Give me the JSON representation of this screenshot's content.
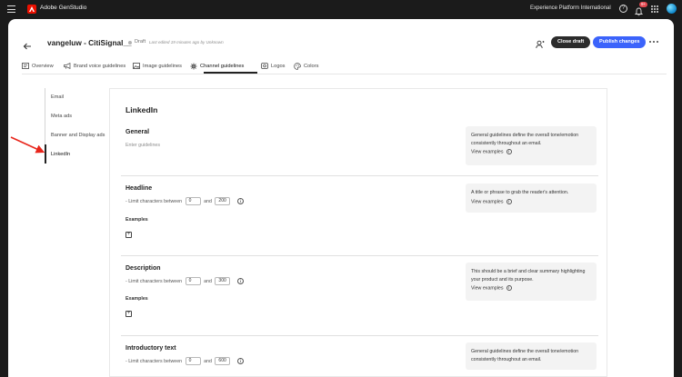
{
  "topbar": {
    "app_name": "Adobe GenStudio",
    "org_name": "Experience Platform International",
    "notification_count": "9+"
  },
  "header": {
    "title": "vangeluw - CitiSignal__",
    "status": "Draft",
    "last_edited": "Last edited 19 minutes ago by Unknown",
    "close_draft_label": "Close draft",
    "publish_label": "Publish changes"
  },
  "tabs": [
    {
      "label": "Overview",
      "icon": "overview-icon"
    },
    {
      "label": "Brand voice guidelines",
      "icon": "megaphone-icon"
    },
    {
      "label": "Image guidelines",
      "icon": "image-icon"
    },
    {
      "label": "Channel guidelines",
      "icon": "channel-icon",
      "active": true
    },
    {
      "label": "Logos",
      "icon": "logo-icon"
    },
    {
      "label": "Colors",
      "icon": "palette-icon"
    }
  ],
  "channels": [
    "Email",
    "Meta ads",
    "Banner and Display ads",
    "LinkedIn"
  ],
  "active_channel": "LinkedIn",
  "content": {
    "channel_title": "LinkedIn",
    "general": {
      "title": "General",
      "placeholder": "Enter guidelines",
      "help": "General guidelines define the overall tone/emotion consistently throughout an email.",
      "view_examples": "View examples"
    },
    "headline": {
      "title": "Headline",
      "limit_prefix": "- Limit characters between",
      "and": "and",
      "min": "0",
      "max": "200",
      "examples_label": "Examples",
      "help": "A title or phrase to grab the reader's attention.",
      "view_examples": "View examples"
    },
    "description": {
      "title": "Description",
      "limit_prefix": "- Limit characters between",
      "and": "and",
      "min": "0",
      "max": "300",
      "examples_label": "Examples",
      "help": "This should be a brief and clear summary highlighting your product and its purpose.",
      "view_examples": "View examples"
    },
    "introductory": {
      "title": "Introductory text",
      "limit_prefix": "- Limit characters between",
      "and": "and",
      "min": "0",
      "max": "600",
      "help": "General guidelines define the overall tone/emotion consistently throughout an email."
    }
  },
  "colors": {
    "accent": "#3b63fb",
    "annotation_arrow": "#e8251b"
  }
}
